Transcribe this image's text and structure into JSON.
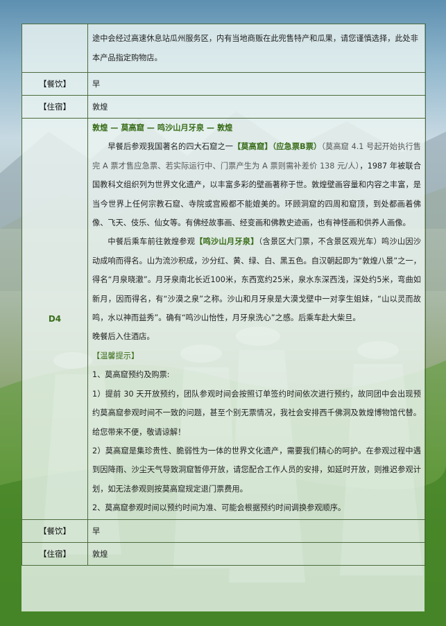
{
  "rows": {
    "top_text_line1": "途中会经过高速休息站瓜州服务区，内有当地商贩在此兜售特产和瓜果，请您谨慎选择，此处非",
    "top_text_line2": "本产品指定购物店。",
    "meal_label_1": "【餐饮】",
    "meal_value_1": "早",
    "stay_label_1": "【住宿】",
    "stay_value_1": "敦煌",
    "day_label": "D4",
    "route": "敦煌 — 莫高窟 — 鸣沙山月牙泉 — 敦煌",
    "p1_a": "早餐后参观我国著名的四大石窟之一",
    "p1_hl": "【莫高窟】（应急票B票）",
    "p1_grey": "（莫高窟 4.1 号起开始执行售完 A 票才售应急票、若实际运行中、门票产生为 A 票则需补差价 138 元/人）",
    "p1_b": "，1987 年被联合国教科文组织列为世界文化遗产，以丰富多彩的壁画著称于世。敦煌壁画容量和内容之丰富，是当今世界上任何宗教石窟、寺院或宫殿都不能媲美的。环顾洞窟的四周和窟顶，到处都画着佛像、飞天、伎乐、仙女等。有佛经故事画、经变画和佛教史迹画，也有神怪画和供养人画像。",
    "p2_a": "中餐后乘车前往敦煌参观",
    "p2_hl": "【鸣沙山月牙泉】",
    "p2_b": "（含景区大门票，不含景区观光车）鸣沙山因沙动成响而得名。山为流沙积成，沙分红、黄、绿、白、黑五色。自汉朝起即为“敦煌八景”之一，得名“月泉晓澈”。月牙泉南北长近100米，东西宽约25米，泉水东深西浅，深处约5米，弯曲如新月，因而得名，有“沙漠之泉”之称。沙山和月牙泉是大漠戈壁中一对孪生姐妹，“山以灵而故鸣，水以神而益秀”。确有“鸣沙山怡性，月牙泉洗心”之感。后乘车赴大柴旦。",
    "p3": "晚餐后入住酒店。",
    "tip_title": "【温馨提示】",
    "tip1": "1、莫高窟预约及购票:",
    "tip2": "1）提前 30 天开放预约，团队参观时间会按照订单签约时间依次进行预约，故同团中会出现预约莫高窟参观时间不一致的问题，甚至个别无票情况，我社会安排西千佛洞及敦煌博物馆代替。给您带来不便，敬请谅解！",
    "tip3": "2）莫高窟是集珍贵性、脆弱性为一体的世界文化遗产，需要我们精心的呵护。在参观过程中遇到因降雨、沙尘天气导致洞窟暂停开放，请您配合工作人员的安排，如延时开放，则推迟参观计划，如无法参观则按莫高窟规定退门票费用。",
    "tip4": "2、莫高窟参观时间以预约时间为准、可能会根据预约时间调换参观顺序。",
    "meal_label_2": "【餐饮】",
    "meal_value_2": "早",
    "stay_label_2": "【住宿】",
    "stay_value_2": "敦煌"
  },
  "colors": {
    "accent_green": "#3a6e1a",
    "border": "#4d6b3c"
  }
}
